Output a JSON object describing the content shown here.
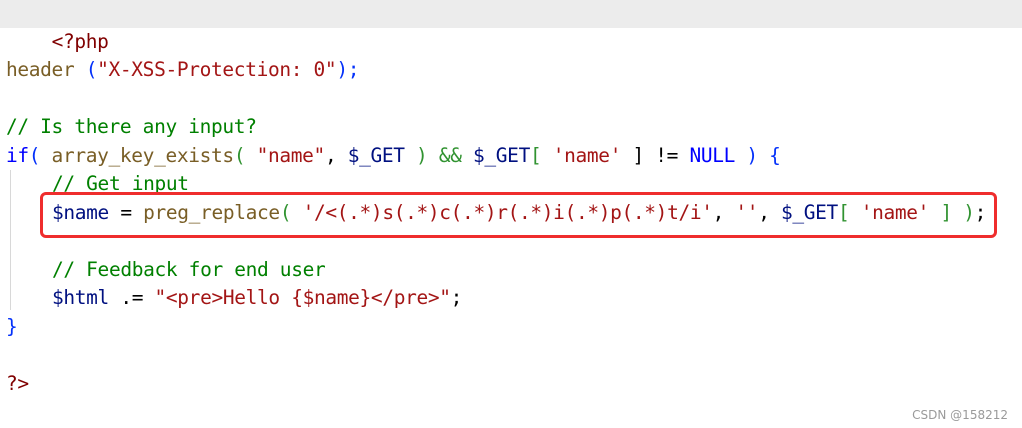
{
  "code": {
    "l1": {
      "a": "<?php"
    },
    "l2": {
      "a": "header",
      "b": " (",
      "c": "\"X-XSS-Protection: 0\"",
      "d": ");"
    },
    "l3": {
      "a": "// Is there any input?"
    },
    "l4": {
      "a": "if",
      "b": "(",
      "c": " array_key_exists",
      "d": "(",
      "e": " \"name\"",
      "f": ", ",
      "g": "$_GET",
      "h": " ) && ",
      "i": "$_GET",
      "j": "[",
      "k": " 'name'",
      "l": " ] != ",
      "m": "NULL",
      "n": " ) ",
      "o": "{"
    },
    "l5": {
      "a": "// Get input"
    },
    "l6": {
      "a": "$name",
      "b": " = ",
      "c": "preg_replace",
      "d": "(",
      "e": " '/<(.*)s(.*)c(.*)r(.*)i(.*)p(.*)t/i'",
      "f": ", ",
      "g": "''",
      "h": ", ",
      "i": "$_GET",
      "j": "[",
      "k": " 'name'",
      "l": " ] ",
      "m": ")",
      "n": ";"
    },
    "l7": {
      "a": "// Feedback for end user"
    },
    "l8": {
      "a": "$html",
      "b": " .= ",
      "c": "\"<pre>Hello {$name}</pre>\"",
      "d": ";"
    },
    "l9": {
      "a": "}"
    },
    "l10": {
      "a": "?>"
    }
  },
  "watermark": "CSDN @158212",
  "colors": {
    "highlight_box": "#ef2d2d",
    "keyword": "#0000ff",
    "function": "#795e26",
    "variable": "#001080",
    "string": "#a31515",
    "comment": "#008000",
    "php_tag": "#800000"
  }
}
